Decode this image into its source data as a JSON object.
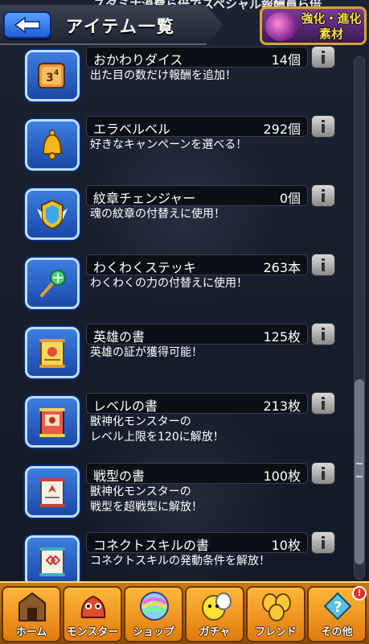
{
  "header": {
    "title": "アイテム一覧",
    "back_label": "back",
    "enhance_label_line1": "強化・進化",
    "enhance_label_line2": "素材"
  },
  "cut_text": "スタミナ消費ら倍でスペシャル報酬員ら倍",
  "items": [
    {
      "name": "おかわりダイス",
      "count": "14個",
      "desc1": "出た目の数だけ報酬を追加！",
      "desc2": "",
      "icon": "dice-icon"
    },
    {
      "name": "エラベルベル",
      "count": "292個",
      "desc1": "好きなキャンペーンを選べる！",
      "desc2": "",
      "icon": "bell-icon"
    },
    {
      "name": "紋章チェンジャー",
      "count": "0個",
      "desc1": "魂の紋章の付替えに使用！",
      "desc2": "",
      "icon": "emblem-changer-icon"
    },
    {
      "name": "わくわくステッキ",
      "count": "263本",
      "desc1": "わくわくの力の付替えに使用！",
      "desc2": "",
      "icon": "wand-icon"
    },
    {
      "name": "英雄の書",
      "count": "125枚",
      "desc1": "英雄の証が獲得可能！",
      "desc2": "",
      "icon": "hero-scroll-icon"
    },
    {
      "name": "レベルの書",
      "count": "213枚",
      "desc1": "獣神化モンスターの",
      "desc2": "レベル上限を120に解放！",
      "icon": "level-scroll-icon"
    },
    {
      "name": "戦型の書",
      "count": "100枚",
      "desc1": "獣神化モンスターの",
      "desc2": "戦型を超戦型に解放！",
      "icon": "battle-type-scroll-icon"
    },
    {
      "name": "コネクトスキルの書",
      "count": "10枚",
      "desc1": "コネクトスキルの発動条件を解放！",
      "desc2": "",
      "icon": "connect-skill-scroll-icon"
    }
  ],
  "nav": [
    {
      "label": "ホーム",
      "icon": "home-icon"
    },
    {
      "label": "モンスター",
      "icon": "monster-icon"
    },
    {
      "label": "ショップ",
      "icon": "shop-orb-icon"
    },
    {
      "label": "ガチャ",
      "icon": "gacha-icon"
    },
    {
      "label": "フレンド",
      "icon": "friend-icon"
    },
    {
      "label": "その他",
      "icon": "other-icon",
      "badge": "!"
    }
  ]
}
